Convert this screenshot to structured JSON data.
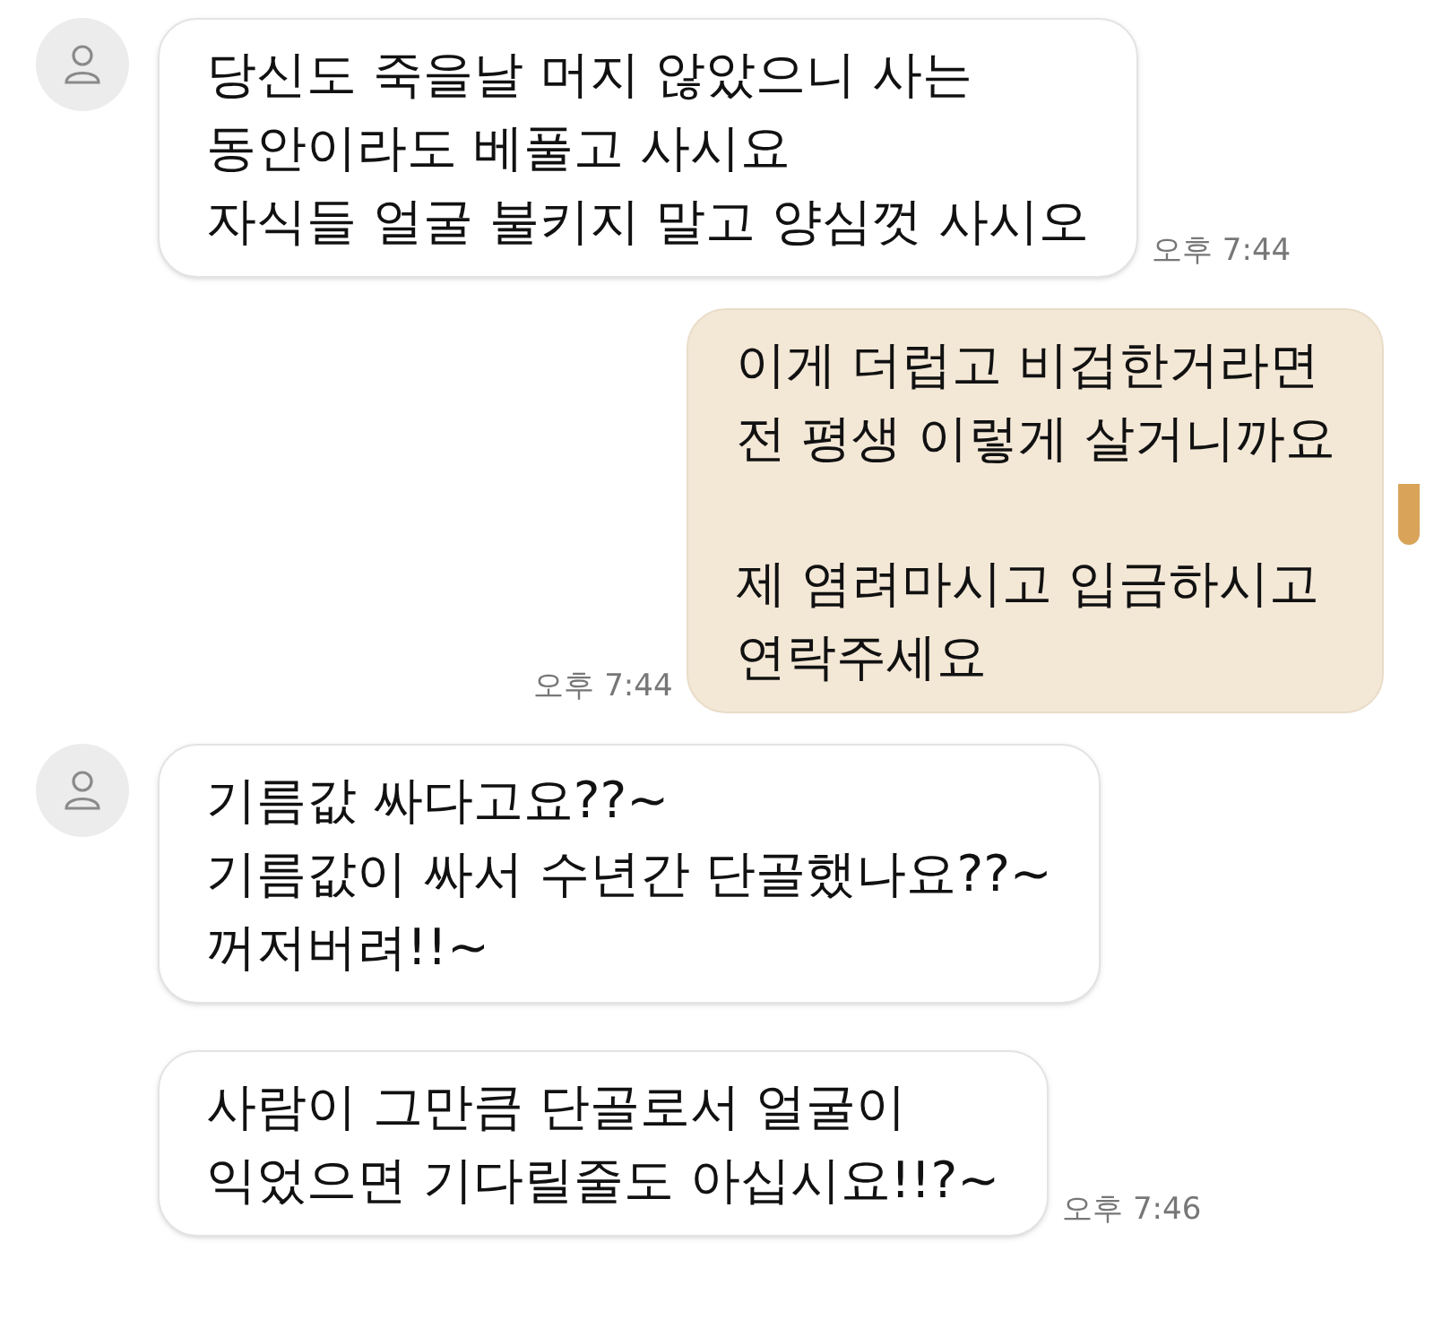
{
  "messages": [
    {
      "kind": "incoming",
      "avatar": true,
      "paragraphs": [
        "당신도 죽을날 머지 않았으니 사는\n동안이라도 베풀고 사시요\n자식들 얼굴 불키지 말고 양심껏 사시오"
      ],
      "time": "오후 7:44"
    },
    {
      "kind": "outgoing",
      "paragraphs": [
        "이게 더럽고 비겁한거라면\n전 평생 이렇게 살거니까요",
        "제 염려마시고 입금하시고\n연락주세요"
      ],
      "time": "오후 7:44"
    },
    {
      "kind": "incoming",
      "avatar": true,
      "paragraphs": [
        "기름값 싸다고요??~\n기름값이 싸서 수년간 단골했나요??~\n꺼저버려!!~"
      ]
    },
    {
      "kind": "incoming",
      "avatar": false,
      "paragraphs": [
        "사람이 그만큼 단골로서 얼굴이\n익었으면 기다릴줄도 아십시요!!?~"
      ],
      "time": "오후 7:46"
    }
  ]
}
